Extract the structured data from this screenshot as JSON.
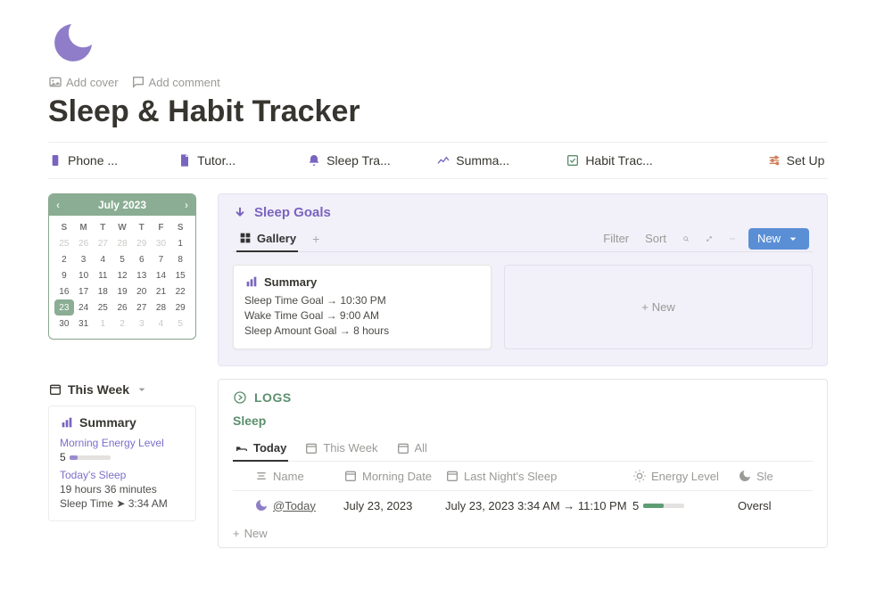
{
  "cover": {
    "add_cover": "Add cover",
    "add_comment": "Add comment"
  },
  "title": "Sleep & Habit Tracker",
  "nav": [
    {
      "label": "Phone ..."
    },
    {
      "label": "Tutor..."
    },
    {
      "label": "Sleep Tra..."
    },
    {
      "label": "Summa..."
    },
    {
      "label": "Habit Trac..."
    },
    {
      "label": "Set Up"
    }
  ],
  "calendar": {
    "month": "July 2023",
    "dow": [
      "S",
      "M",
      "T",
      "W",
      "T",
      "F",
      "S"
    ],
    "rows": [
      [
        {
          "n": "25",
          "dim": true
        },
        {
          "n": "26",
          "dim": true
        },
        {
          "n": "27",
          "dim": true
        },
        {
          "n": "28",
          "dim": true
        },
        {
          "n": "29",
          "dim": true
        },
        {
          "n": "30",
          "dim": true
        },
        {
          "n": "1"
        }
      ],
      [
        {
          "n": "2"
        },
        {
          "n": "3"
        },
        {
          "n": "4"
        },
        {
          "n": "5"
        },
        {
          "n": "6"
        },
        {
          "n": "7"
        },
        {
          "n": "8"
        }
      ],
      [
        {
          "n": "9"
        },
        {
          "n": "10"
        },
        {
          "n": "11"
        },
        {
          "n": "12"
        },
        {
          "n": "13"
        },
        {
          "n": "14"
        },
        {
          "n": "15"
        }
      ],
      [
        {
          "n": "16"
        },
        {
          "n": "17"
        },
        {
          "n": "18"
        },
        {
          "n": "19"
        },
        {
          "n": "20"
        },
        {
          "n": "21"
        },
        {
          "n": "22"
        }
      ],
      [
        {
          "n": "23",
          "sel": true
        },
        {
          "n": "24"
        },
        {
          "n": "25"
        },
        {
          "n": "26"
        },
        {
          "n": "27"
        },
        {
          "n": "28"
        },
        {
          "n": "29"
        }
      ],
      [
        {
          "n": "30"
        },
        {
          "n": "31"
        },
        {
          "n": "1",
          "dim": true
        },
        {
          "n": "2",
          "dim": true
        },
        {
          "n": "3",
          "dim": true
        },
        {
          "n": "4",
          "dim": true
        },
        {
          "n": "5",
          "dim": true
        }
      ]
    ]
  },
  "thisweek": {
    "label": "This Week",
    "summary": {
      "title": "Summary",
      "energy_label": "Morning Energy Level",
      "energy_value": "5",
      "todays_sleep_label": "Today's Sleep",
      "duration": "19 hours 36 minutes",
      "sleep_time": "Sleep Time ➤ 3:34 AM"
    }
  },
  "goals": {
    "title": "Sleep Goals",
    "tab_gallery": "Gallery",
    "filter": "Filter",
    "sort": "Sort",
    "new": "New",
    "card": {
      "title": "Summary",
      "line1": "Sleep Time Goal → 10:30 PM",
      "line2": "Wake Time Goal → 9:00 AM",
      "line3": "Sleep Amount Goal → 8 hours"
    },
    "new_card": "New"
  },
  "logs": {
    "title": "LOGS",
    "subtitle": "Sleep",
    "tabs": {
      "today": "Today",
      "thisweek": "This Week",
      "all": "All"
    },
    "columns": {
      "name": "Name",
      "date": "Morning Date",
      "sleep": "Last Night's Sleep",
      "energy": "Energy Level",
      "over": "Sle"
    },
    "row": {
      "name": "@Today",
      "date": "July 23, 2023",
      "sleep": "July 23, 2023 3:34 AM → 11:10 PM",
      "energy": "5",
      "over": "Oversl"
    },
    "new": "New"
  }
}
